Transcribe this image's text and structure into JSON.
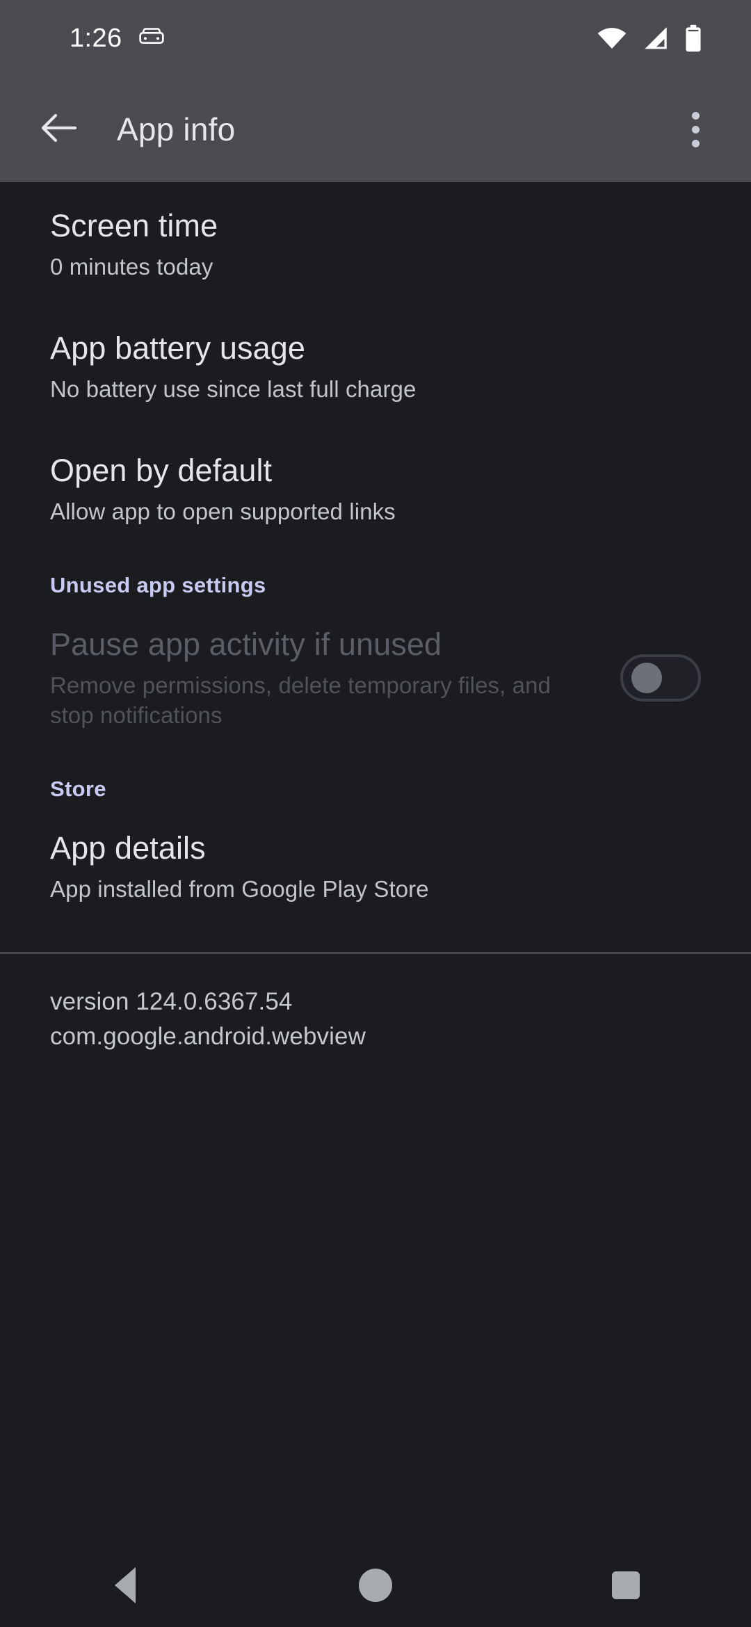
{
  "statusbar": {
    "time": "1:26",
    "icons": [
      "car-icon",
      "wifi-icon",
      "cell-signal-icon",
      "battery-icon"
    ]
  },
  "appbar": {
    "title": "App info",
    "back_icon": "arrow-back-icon",
    "overflow_icon": "more-vert-icon"
  },
  "preferences": [
    {
      "title": "Screen time",
      "summary": "0 minutes today"
    },
    {
      "title": "App battery usage",
      "summary": "No battery use since last full charge"
    },
    {
      "title": "Open by default",
      "summary": "Allow app to open supported links"
    }
  ],
  "unused_section": {
    "header": "Unused app settings",
    "pause": {
      "title": "Pause app activity if unused",
      "summary": "Remove permissions, delete temporary files, and stop notifications",
      "toggle_state": "off",
      "enabled": false
    }
  },
  "store_section": {
    "header": "Store",
    "app_details": {
      "title": "App details",
      "summary": "App installed from Google Play Store"
    }
  },
  "footer": {
    "version": "version 124.0.6367.54",
    "package": "com.google.android.webview"
  },
  "navbar": {
    "back": "nav-back-icon",
    "home": "nav-home-icon",
    "recents": "nav-recents-icon"
  },
  "colors": {
    "appbar_bg": "#4a4b50",
    "content_bg": "#1b1c20",
    "section_accent": "#c7cbf2",
    "primary_text": "#e5e6eb",
    "secondary_text": "#c3c5cc",
    "disabled_text": "#5b5e66"
  }
}
